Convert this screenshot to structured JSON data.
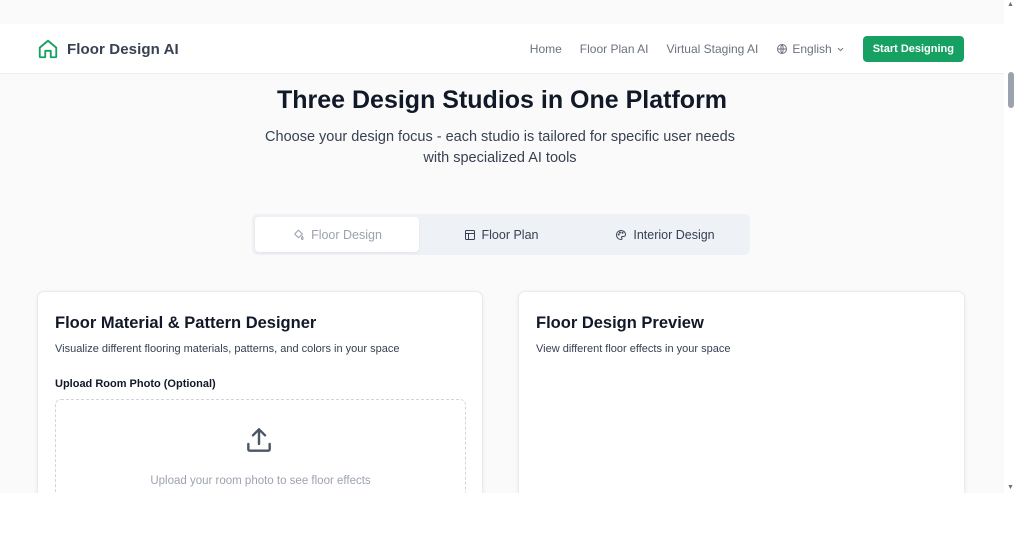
{
  "header": {
    "brand": "Floor Design AI",
    "nav": [
      "Home",
      "Floor Plan AI",
      "Virtual Staging AI"
    ],
    "language": "English",
    "cta": "Start Designing"
  },
  "hero": {
    "title": "Three Design Studios in One Platform",
    "subtitle_line1": "Choose your design focus - each studio is tailored for specific user needs",
    "subtitle_line2": "with specialized AI tools"
  },
  "tabs": [
    {
      "label": "Floor Design",
      "icon": "paint-bucket-icon",
      "active": true
    },
    {
      "label": "Floor Plan",
      "icon": "layout-icon",
      "active": false
    },
    {
      "label": "Interior Design",
      "icon": "palette-icon",
      "active": false
    }
  ],
  "left_card": {
    "title": "Floor Material & Pattern Designer",
    "description": "Visualize different flooring materials, patterns, and colors in your space",
    "upload_label": "Upload Room Photo (Optional)",
    "upload_text": "Upload your room photo to see floor effects"
  },
  "right_card": {
    "title": "Floor Design Preview",
    "description": "View different floor effects in your space"
  },
  "colors": {
    "accent": "#16a163",
    "logo": "#16a163",
    "tab_background": "#eef1f5"
  }
}
